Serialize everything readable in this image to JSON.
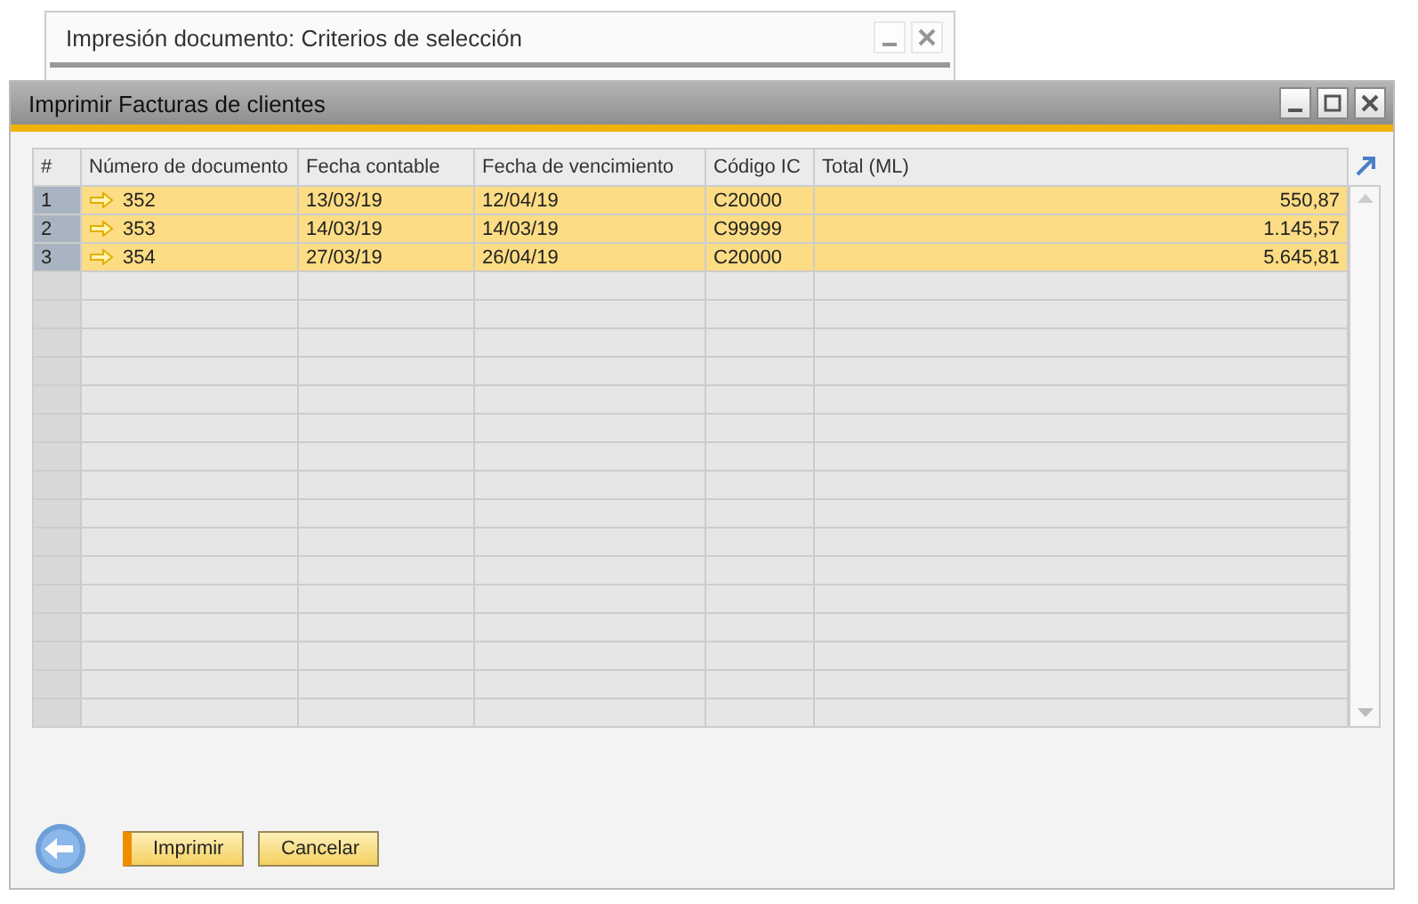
{
  "background_window": {
    "title": "Impresión documento: Criterios de selección"
  },
  "window": {
    "title": "Imprimir Facturas de clientes"
  },
  "table": {
    "columns": [
      "#",
      "Número de documento",
      "Fecha contable",
      "Fecha de vencimiento",
      "Código IC",
      "Total (ML)"
    ],
    "rows": [
      {
        "row_number": "1",
        "document_number": "352",
        "posting_date": "13/03/19",
        "due_date": "12/04/19",
        "bp_code": "C20000",
        "total": "550,87",
        "selected": true
      },
      {
        "row_number": "2",
        "document_number": "353",
        "posting_date": "14/03/19",
        "due_date": "14/03/19",
        "bp_code": "C99999",
        "total": "1.145,57",
        "selected": true
      },
      {
        "row_number": "3",
        "document_number": "354",
        "posting_date": "27/03/19",
        "due_date": "26/04/19",
        "bp_code": "C20000",
        "total": "5.645,81",
        "selected": true
      }
    ]
  },
  "buttons": [
    {
      "label": "Imprimir",
      "kind": "primary"
    },
    {
      "label": "Cancelar",
      "kind": "secondary"
    }
  ]
}
